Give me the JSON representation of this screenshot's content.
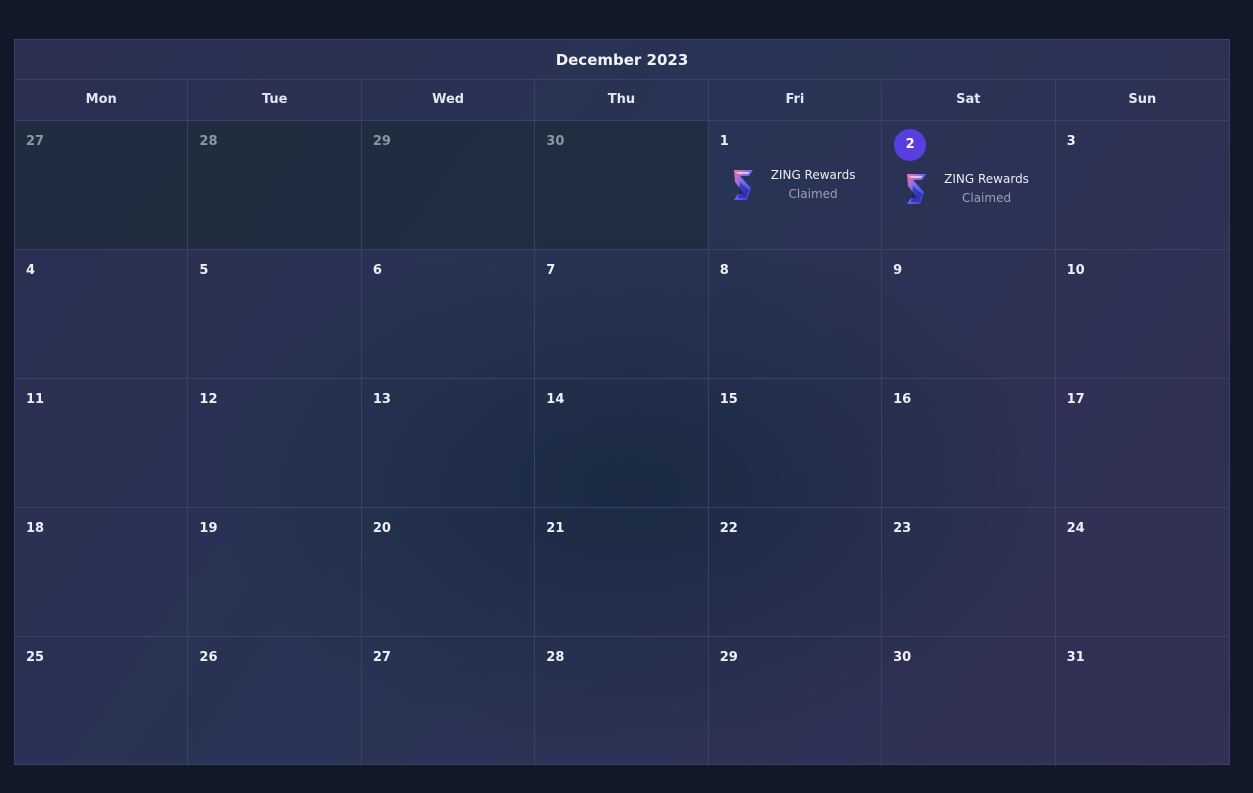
{
  "calendar": {
    "title": "December 2023",
    "weekdays": [
      "Mon",
      "Tue",
      "Wed",
      "Thu",
      "Fri",
      "Sat",
      "Sun"
    ],
    "days": [
      {
        "num": "27",
        "outside": true
      },
      {
        "num": "28",
        "outside": true
      },
      {
        "num": "29",
        "outside": true
      },
      {
        "num": "30",
        "outside": true
      },
      {
        "num": "1",
        "event": {
          "title": "ZING Rewards",
          "status": "Claimed"
        }
      },
      {
        "num": "2",
        "today": true,
        "event": {
          "title": "ZING Rewards",
          "status": "Claimed"
        }
      },
      {
        "num": "3"
      },
      {
        "num": "4"
      },
      {
        "num": "5"
      },
      {
        "num": "6"
      },
      {
        "num": "7"
      },
      {
        "num": "8"
      },
      {
        "num": "9"
      },
      {
        "num": "10"
      },
      {
        "num": "11"
      },
      {
        "num": "12"
      },
      {
        "num": "13"
      },
      {
        "num": "14"
      },
      {
        "num": "15"
      },
      {
        "num": "16"
      },
      {
        "num": "17"
      },
      {
        "num": "18"
      },
      {
        "num": "19"
      },
      {
        "num": "20"
      },
      {
        "num": "21"
      },
      {
        "num": "22"
      },
      {
        "num": "23"
      },
      {
        "num": "24"
      },
      {
        "num": "25"
      },
      {
        "num": "26"
      },
      {
        "num": "27"
      },
      {
        "num": "28"
      },
      {
        "num": "29"
      },
      {
        "num": "30"
      },
      {
        "num": "31"
      }
    ],
    "event_icon": "zing-logo-icon",
    "colors": {
      "accent_today": "#5a3fe0",
      "background": "#111828"
    }
  }
}
